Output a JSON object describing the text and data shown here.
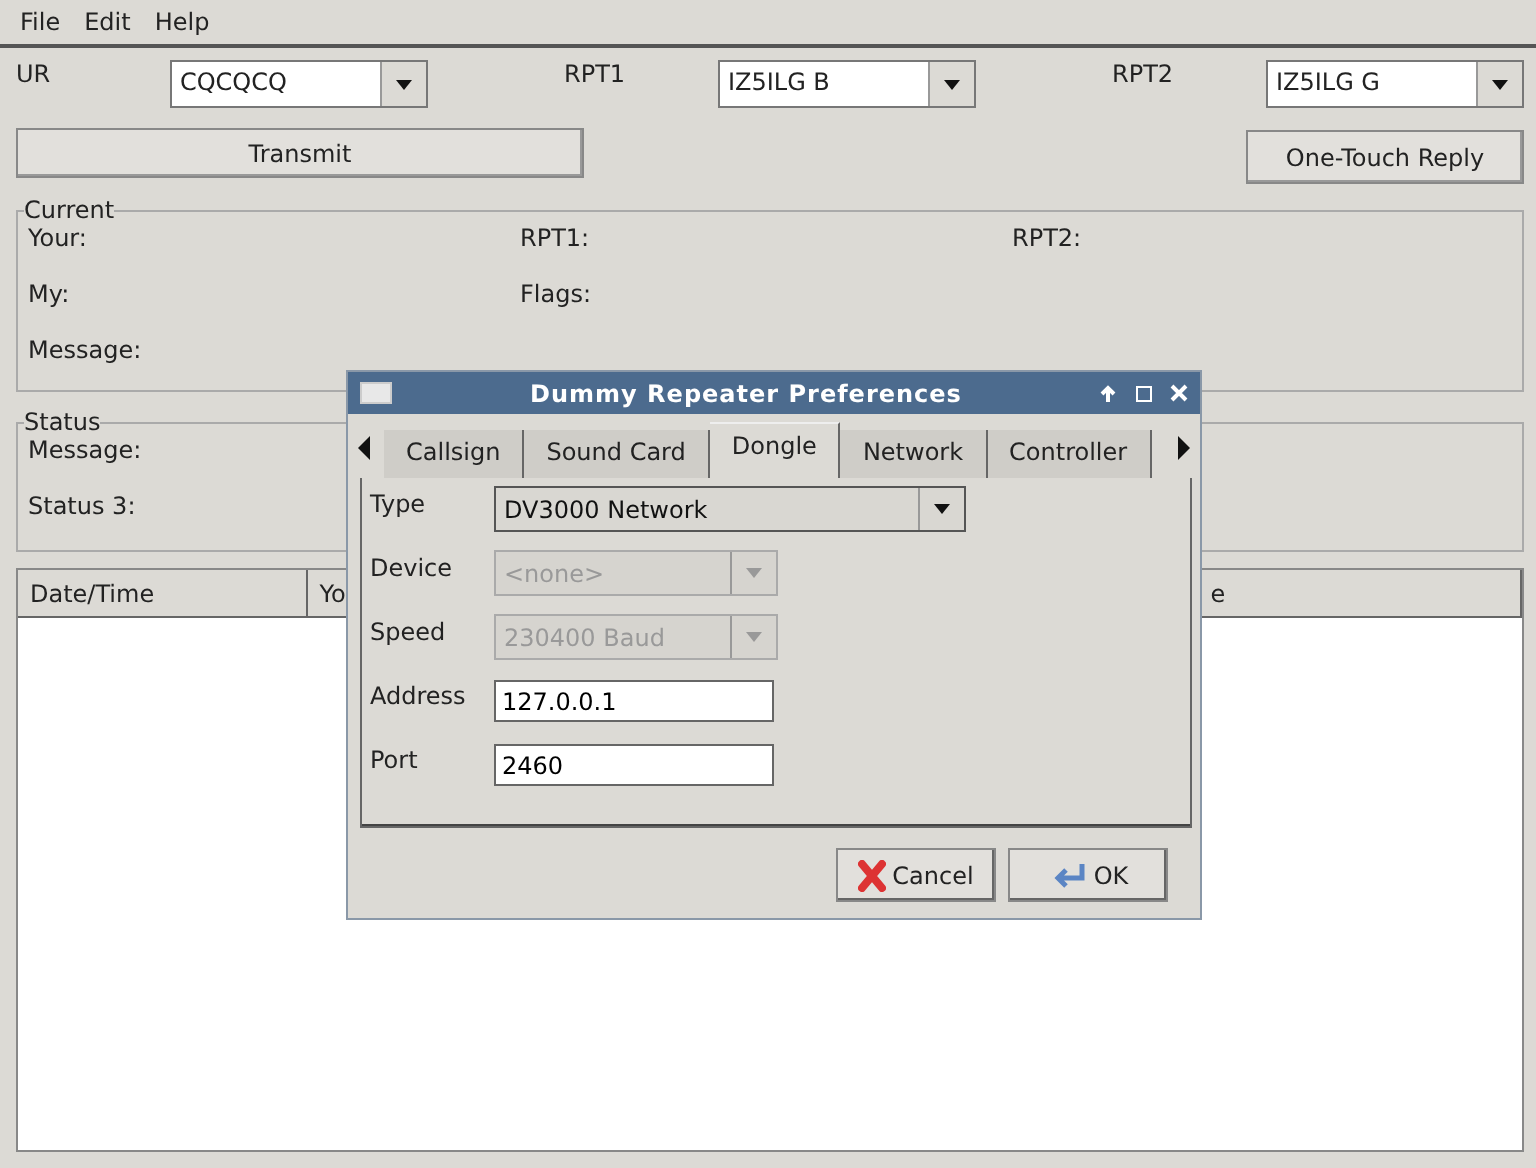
{
  "menu": [
    "File",
    "Edit",
    "Help"
  ],
  "routing": [
    {
      "label": "UR",
      "value": "CQCQCQ"
    },
    {
      "label": "RPT1",
      "value": "IZ5ILG B"
    },
    {
      "label": "RPT2",
      "value": "IZ5ILG G"
    }
  ],
  "buttons": {
    "transmit": "Transmit",
    "reply": "One-Touch Reply"
  },
  "current": {
    "title": "Current",
    "fields": [
      [
        "Your:",
        "RPT1:",
        "RPT2:"
      ],
      [
        "My:",
        "Flags:"
      ],
      [
        "Message:"
      ]
    ]
  },
  "status": {
    "title": "Status",
    "fields": [
      "Message:",
      "Status 3:"
    ]
  },
  "table": {
    "columns": [
      "Date/Time",
      "Yo",
      "e"
    ]
  },
  "dialog": {
    "title": "Dummy Repeater Preferences",
    "tabs": [
      {
        "label": "Callsign",
        "selected": false
      },
      {
        "label": "Sound Card",
        "selected": false
      },
      {
        "label": "Dongle",
        "selected": true
      },
      {
        "label": "Network",
        "selected": false
      },
      {
        "label": "Controller",
        "selected": false
      }
    ],
    "rows": [
      {
        "kind": "select",
        "label": "Type",
        "value": "DV3000 Network",
        "disabled": false
      },
      {
        "kind": "select",
        "label": "Device",
        "value": "<none>",
        "disabled": true
      },
      {
        "kind": "select",
        "label": "Speed",
        "value": "230400 Baud",
        "disabled": true
      },
      {
        "kind": "input",
        "label": "Address",
        "value": "127.0.0.1"
      },
      {
        "kind": "input",
        "label": "Port",
        "value": "2460"
      }
    ],
    "cancel": "Cancel",
    "ok": "OK"
  }
}
